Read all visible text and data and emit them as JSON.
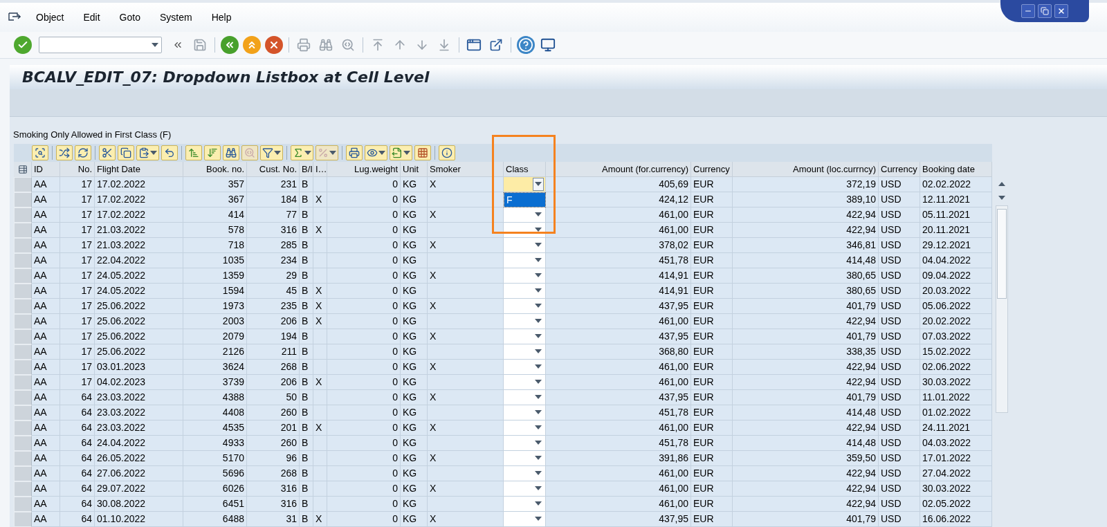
{
  "menu": [
    {
      "label": "Object"
    },
    {
      "label": "Edit"
    },
    {
      "label": "Goto"
    },
    {
      "label": "System"
    },
    {
      "label": "Help"
    }
  ],
  "window_title": "BCALV_EDIT_07: Dropdown Listbox at Cell Level",
  "grid_caption": "Smoking Only Allowed in First Class (F)",
  "columns": [
    {
      "label": "ID",
      "kind": "text"
    },
    {
      "label": "No.",
      "kind": "number"
    },
    {
      "label": "Flight Date",
      "kind": "text"
    },
    {
      "label": "Book. no.",
      "kind": "number"
    },
    {
      "label": "Cust. No.",
      "kind": "number"
    },
    {
      "label": "B/I",
      "kind": "text"
    },
    {
      "label": "I…",
      "kind": "text"
    },
    {
      "label": "Lug.weight",
      "kind": "number"
    },
    {
      "label": "Unit",
      "kind": "text"
    },
    {
      "label": "Smoker",
      "kind": "text"
    },
    {
      "label": "Class",
      "kind": "dropdown"
    },
    {
      "label": "Amount (for.currency)",
      "kind": "number"
    },
    {
      "label": "Currency",
      "kind": "text"
    },
    {
      "label": "Amount (loc.currncy)",
      "kind": "number"
    },
    {
      "label": "Currency",
      "kind": "text"
    },
    {
      "label": "Booking date",
      "kind": "text"
    }
  ],
  "rows": [
    {
      "id": "AA",
      "no": "17",
      "flight_date": "17.02.2022",
      "book_no": "357",
      "cust_no": "231",
      "b_i": "B",
      "lug_weight": "0",
      "unit": "KG",
      "smoker": "X",
      "amount_for": "405,69",
      "currency_for": "EUR",
      "amount_loc": "372,19",
      "currency_loc": "USD",
      "booking_date": "02.02.2022",
      "focused": true
    },
    {
      "id": "AA",
      "no": "17",
      "flight_date": "17.02.2022",
      "book_no": "367",
      "cust_no": "184",
      "b_i": "B",
      "i": "X",
      "lug_weight": "0",
      "unit": "KG",
      "amount_for": "424,12",
      "currency_for": "EUR",
      "amount_loc": "389,10",
      "currency_loc": "USD",
      "booking_date": "12.11.2021",
      "focused": false
    },
    {
      "id": "AA",
      "no": "17",
      "flight_date": "17.02.2022",
      "book_no": "414",
      "cust_no": "77",
      "b_i": "B",
      "lug_weight": "0",
      "unit": "KG",
      "smoker": "X",
      "amount_for": "461,00",
      "currency_for": "EUR",
      "amount_loc": "422,94",
      "currency_loc": "USD",
      "booking_date": "05.11.2021",
      "focused": false
    },
    {
      "id": "AA",
      "no": "17",
      "flight_date": "21.03.2022",
      "book_no": "578",
      "cust_no": "316",
      "b_i": "B",
      "i": "X",
      "lug_weight": "0",
      "unit": "KG",
      "amount_for": "461,00",
      "currency_for": "EUR",
      "amount_loc": "422,94",
      "currency_loc": "USD",
      "booking_date": "20.11.2021",
      "focused": false
    },
    {
      "id": "AA",
      "no": "17",
      "flight_date": "21.03.2022",
      "book_no": "718",
      "cust_no": "285",
      "b_i": "B",
      "lug_weight": "0",
      "unit": "KG",
      "smoker": "X",
      "amount_for": "378,02",
      "currency_for": "EUR",
      "amount_loc": "346,81",
      "currency_loc": "USD",
      "booking_date": "29.12.2021",
      "focused": false
    },
    {
      "id": "AA",
      "no": "17",
      "flight_date": "22.04.2022",
      "book_no": "1035",
      "cust_no": "234",
      "b_i": "B",
      "lug_weight": "0",
      "unit": "KG",
      "amount_for": "451,78",
      "currency_for": "EUR",
      "amount_loc": "414,48",
      "currency_loc": "USD",
      "booking_date": "04.04.2022",
      "focused": false
    },
    {
      "id": "AA",
      "no": "17",
      "flight_date": "24.05.2022",
      "book_no": "1359",
      "cust_no": "29",
      "b_i": "B",
      "lug_weight": "0",
      "unit": "KG",
      "smoker": "X",
      "amount_for": "414,91",
      "currency_for": "EUR",
      "amount_loc": "380,65",
      "currency_loc": "USD",
      "booking_date": "09.04.2022",
      "focused": false
    },
    {
      "id": "AA",
      "no": "17",
      "flight_date": "24.05.2022",
      "book_no": "1594",
      "cust_no": "45",
      "b_i": "B",
      "i": "X",
      "lug_weight": "0",
      "unit": "KG",
      "amount_for": "414,91",
      "currency_for": "EUR",
      "amount_loc": "380,65",
      "currency_loc": "USD",
      "booking_date": "20.03.2022",
      "focused": false
    },
    {
      "id": "AA",
      "no": "17",
      "flight_date": "25.06.2022",
      "book_no": "1973",
      "cust_no": "235",
      "b_i": "B",
      "i": "X",
      "lug_weight": "0",
      "unit": "KG",
      "smoker": "X",
      "amount_for": "437,95",
      "currency_for": "EUR",
      "amount_loc": "401,79",
      "currency_loc": "USD",
      "booking_date": "05.06.2022",
      "focused": false
    },
    {
      "id": "AA",
      "no": "17",
      "flight_date": "25.06.2022",
      "book_no": "2003",
      "cust_no": "206",
      "b_i": "B",
      "i": "X",
      "lug_weight": "0",
      "unit": "KG",
      "amount_for": "461,00",
      "currency_for": "EUR",
      "amount_loc": "422,94",
      "currency_loc": "USD",
      "booking_date": "20.02.2022",
      "focused": false
    },
    {
      "id": "AA",
      "no": "17",
      "flight_date": "25.06.2022",
      "book_no": "2079",
      "cust_no": "194",
      "b_i": "B",
      "lug_weight": "0",
      "unit": "KG",
      "smoker": "X",
      "amount_for": "437,95",
      "currency_for": "EUR",
      "amount_loc": "401,79",
      "currency_loc": "USD",
      "booking_date": "07.03.2022",
      "focused": false
    },
    {
      "id": "AA",
      "no": "17",
      "flight_date": "25.06.2022",
      "book_no": "2126",
      "cust_no": "211",
      "b_i": "B",
      "lug_weight": "0",
      "unit": "KG",
      "amount_for": "368,80",
      "currency_for": "EUR",
      "amount_loc": "338,35",
      "currency_loc": "USD",
      "booking_date": "15.02.2022",
      "focused": false
    },
    {
      "id": "AA",
      "no": "17",
      "flight_date": "03.01.2023",
      "book_no": "3624",
      "cust_no": "268",
      "b_i": "B",
      "lug_weight": "0",
      "unit": "KG",
      "smoker": "X",
      "amount_for": "461,00",
      "currency_for": "EUR",
      "amount_loc": "422,94",
      "currency_loc": "USD",
      "booking_date": "02.06.2022",
      "focused": false
    },
    {
      "id": "AA",
      "no": "17",
      "flight_date": "04.02.2023",
      "book_no": "3739",
      "cust_no": "206",
      "b_i": "B",
      "i": "X",
      "lug_weight": "0",
      "unit": "KG",
      "amount_for": "461,00",
      "currency_for": "EUR",
      "amount_loc": "422,94",
      "currency_loc": "USD",
      "booking_date": "30.03.2022",
      "focused": false
    },
    {
      "id": "AA",
      "no": "64",
      "flight_date": "23.03.2022",
      "book_no": "4388",
      "cust_no": "50",
      "b_i": "B",
      "lug_weight": "0",
      "unit": "KG",
      "smoker": "X",
      "amount_for": "437,95",
      "currency_for": "EUR",
      "amount_loc": "401,79",
      "currency_loc": "USD",
      "booking_date": "11.01.2022",
      "focused": false
    },
    {
      "id": "AA",
      "no": "64",
      "flight_date": "23.03.2022",
      "book_no": "4408",
      "cust_no": "260",
      "b_i": "B",
      "lug_weight": "0",
      "unit": "KG",
      "amount_for": "451,78",
      "currency_for": "EUR",
      "amount_loc": "414,48",
      "currency_loc": "USD",
      "booking_date": "01.02.2022",
      "focused": false
    },
    {
      "id": "AA",
      "no": "64",
      "flight_date": "23.03.2022",
      "book_no": "4535",
      "cust_no": "201",
      "b_i": "B",
      "i": "X",
      "lug_weight": "0",
      "unit": "KG",
      "smoker": "X",
      "amount_for": "461,00",
      "currency_for": "EUR",
      "amount_loc": "422,94",
      "currency_loc": "USD",
      "booking_date": "24.11.2021",
      "focused": false
    },
    {
      "id": "AA",
      "no": "64",
      "flight_date": "24.04.2022",
      "book_no": "4933",
      "cust_no": "260",
      "b_i": "B",
      "lug_weight": "0",
      "unit": "KG",
      "amount_for": "451,78",
      "currency_for": "EUR",
      "amount_loc": "414,48",
      "currency_loc": "USD",
      "booking_date": "04.03.2022",
      "focused": false
    },
    {
      "id": "AA",
      "no": "64",
      "flight_date": "26.05.2022",
      "book_no": "5170",
      "cust_no": "96",
      "b_i": "B",
      "lug_weight": "0",
      "unit": "KG",
      "smoker": "X",
      "amount_for": "391,86",
      "currency_for": "EUR",
      "amount_loc": "359,50",
      "currency_loc": "USD",
      "booking_date": "17.01.2022",
      "focused": false
    },
    {
      "id": "AA",
      "no": "64",
      "flight_date": "27.06.2022",
      "book_no": "5696",
      "cust_no": "268",
      "b_i": "B",
      "lug_weight": "0",
      "unit": "KG",
      "amount_for": "461,00",
      "currency_for": "EUR",
      "amount_loc": "422,94",
      "currency_loc": "USD",
      "booking_date": "27.04.2022",
      "focused": false
    },
    {
      "id": "AA",
      "no": "64",
      "flight_date": "29.07.2022",
      "book_no": "6026",
      "cust_no": "316",
      "b_i": "B",
      "lug_weight": "0",
      "unit": "KG",
      "smoker": "X",
      "amount_for": "461,00",
      "currency_for": "EUR",
      "amount_loc": "422,94",
      "currency_loc": "USD",
      "booking_date": "30.03.2022",
      "focused": false
    },
    {
      "id": "AA",
      "no": "64",
      "flight_date": "30.08.2022",
      "book_no": "6451",
      "cust_no": "316",
      "b_i": "B",
      "lug_weight": "0",
      "unit": "KG",
      "amount_for": "461,00",
      "currency_for": "EUR",
      "amount_loc": "422,94",
      "currency_loc": "USD",
      "booking_date": "02.05.2022",
      "focused": false
    },
    {
      "id": "AA",
      "no": "64",
      "flight_date": "01.10.2022",
      "book_no": "6488",
      "cust_no": "31",
      "b_i": "B",
      "i": "X",
      "lug_weight": "0",
      "unit": "KG",
      "smoker": "X",
      "amount_for": "437,95",
      "currency_for": "EUR",
      "amount_loc": "401,79",
      "currency_loc": "USD",
      "booking_date": "16.06.2022",
      "focused": false
    }
  ],
  "class_dropdown": {
    "options": [
      {
        "label": "F",
        "selected": true
      }
    ]
  },
  "highlight_frame_on_dropdown_column": true
}
